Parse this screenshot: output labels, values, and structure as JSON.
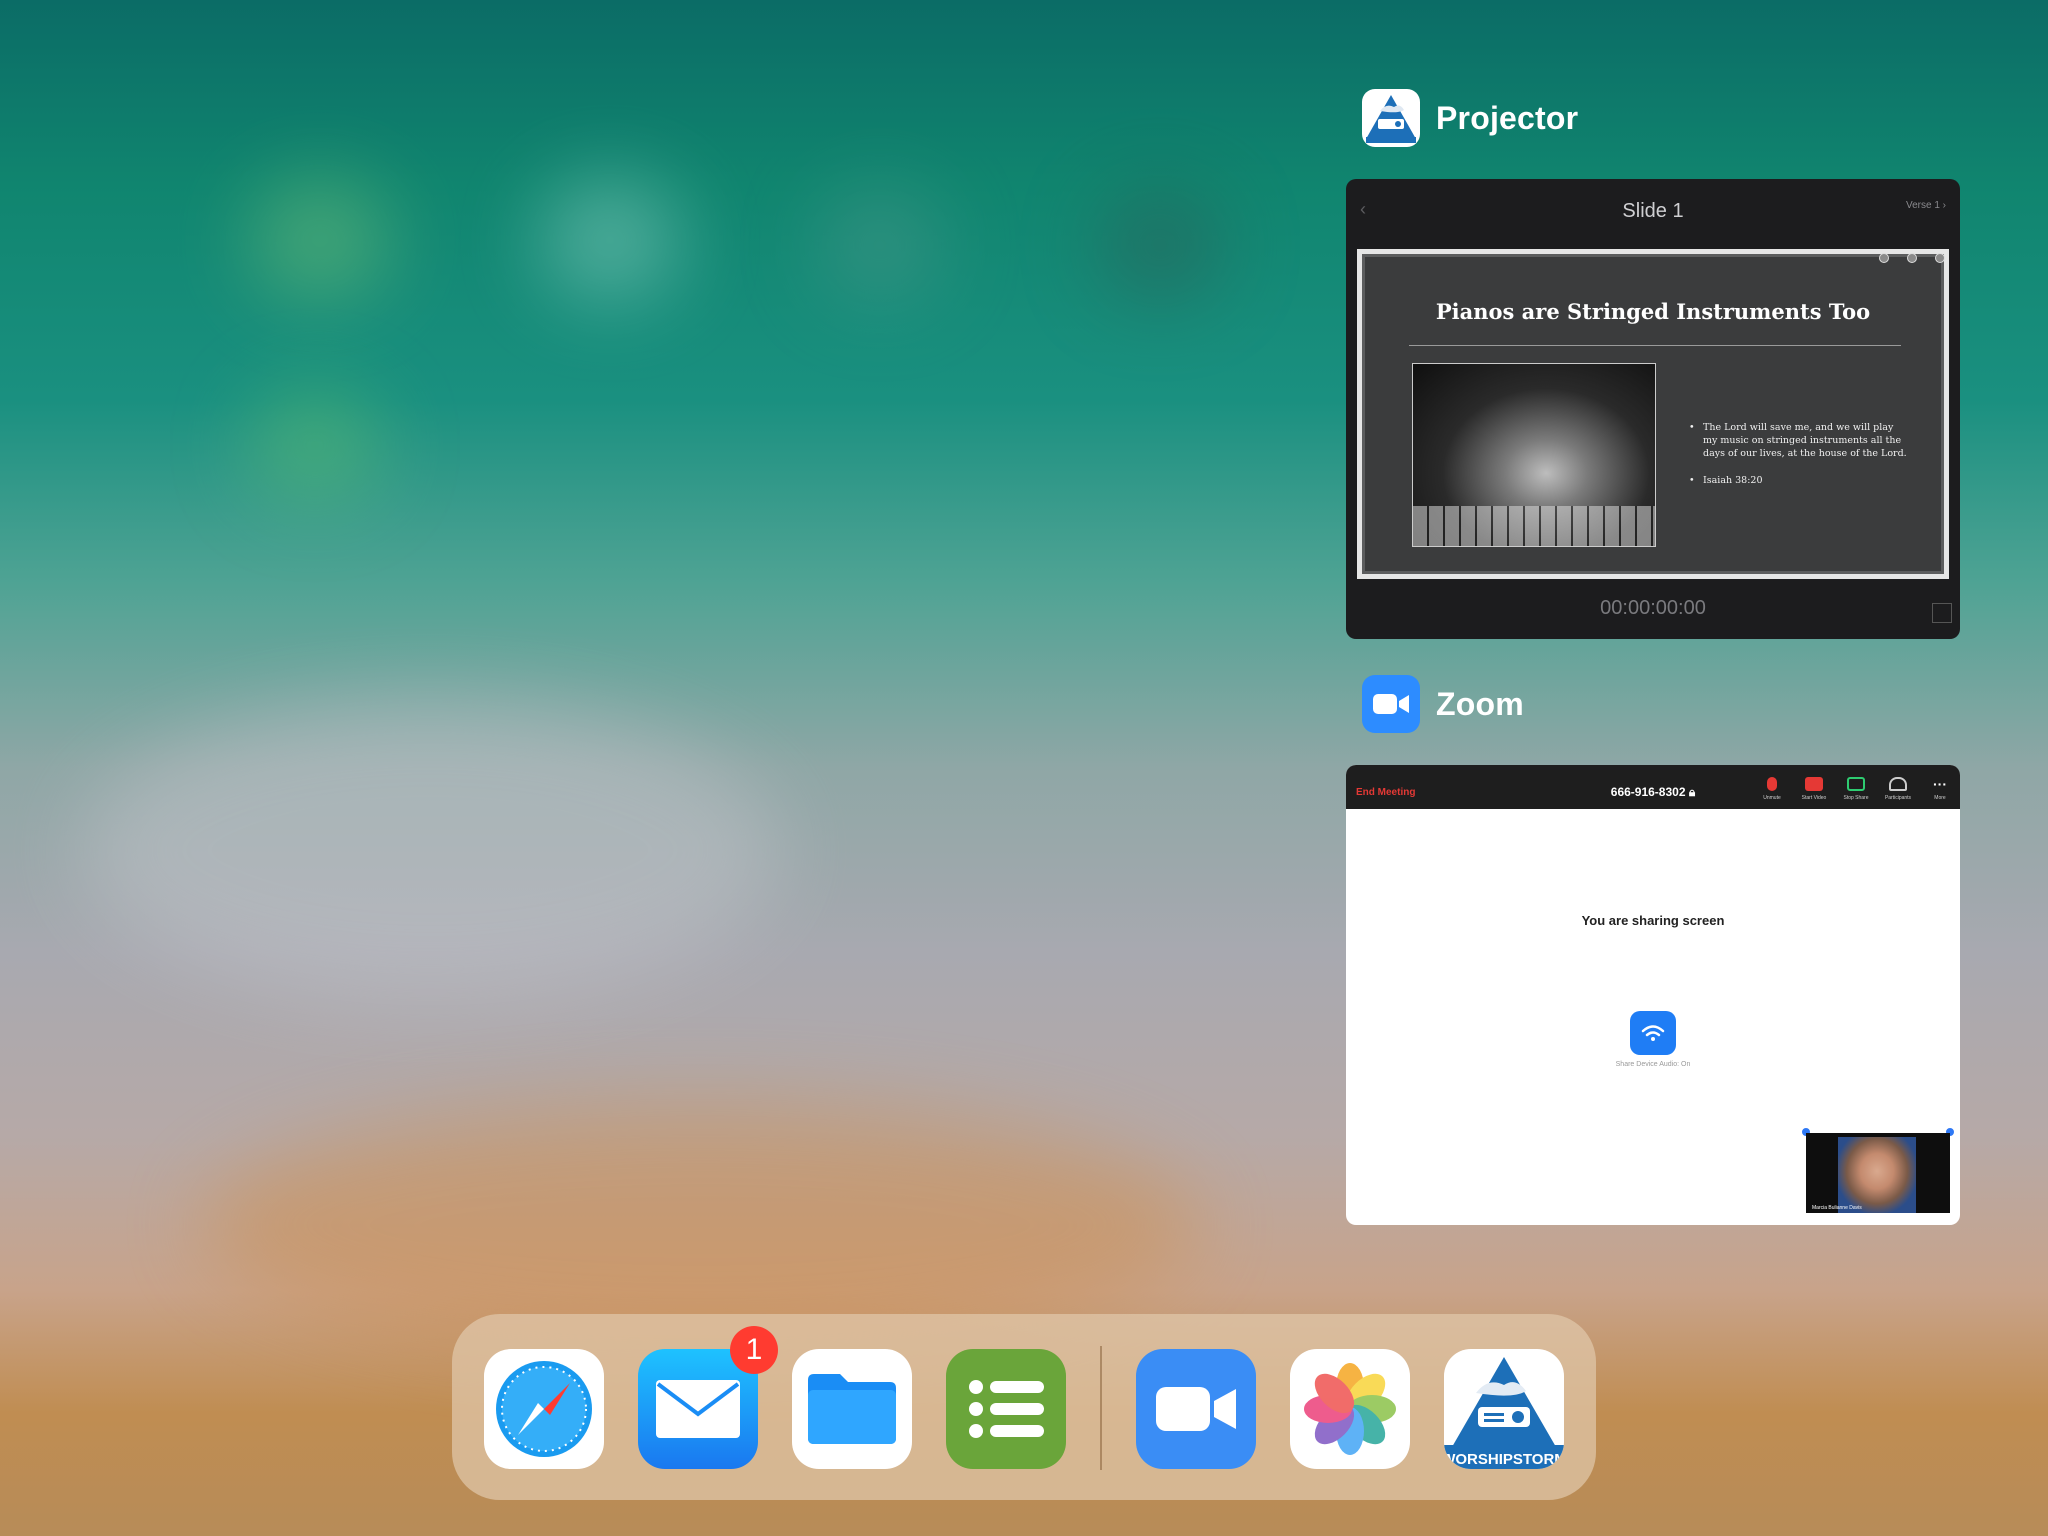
{
  "switcher": {
    "projector": {
      "app_name": "Projector",
      "slide_title": "Slide 1",
      "verse_label": "Verse 1",
      "slide_heading": "Pianos are Stringed Instruments Too",
      "bullets": [
        "The Lord will save me, and we will play my music on stringed instruments all the days of our lives, at the house of the Lord.",
        "Isaiah 38:20"
      ],
      "timer": "00:00:00:00"
    },
    "zoom": {
      "app_name": "Zoom",
      "end_meeting": "End Meeting",
      "meeting_id": "666-916-8302",
      "tools": [
        "Unmute",
        "Start Video",
        "Stop Share",
        "Participants",
        "More"
      ],
      "sharing_text": "You are sharing screen",
      "share_audio_label": "Share Device Audio: On",
      "self_name": "Marcia Bulianne Davis"
    }
  },
  "dock": {
    "apps": [
      {
        "name": "Safari",
        "icon": "safari-icon"
      },
      {
        "name": "Mail",
        "icon": "mail-icon",
        "badge": "1"
      },
      {
        "name": "Files",
        "icon": "files-icon"
      },
      {
        "name": "Lists",
        "icon": "list-icon"
      },
      {
        "name": "Zoom",
        "icon": "zoom-camera-icon"
      },
      {
        "name": "Photos",
        "icon": "photos-icon"
      },
      {
        "name": "WorshipStorm",
        "icon": "worshipstorm-icon"
      }
    ],
    "mail_badge": "1",
    "worshipstorm_wordmark": "WORSHIPSTORM"
  }
}
